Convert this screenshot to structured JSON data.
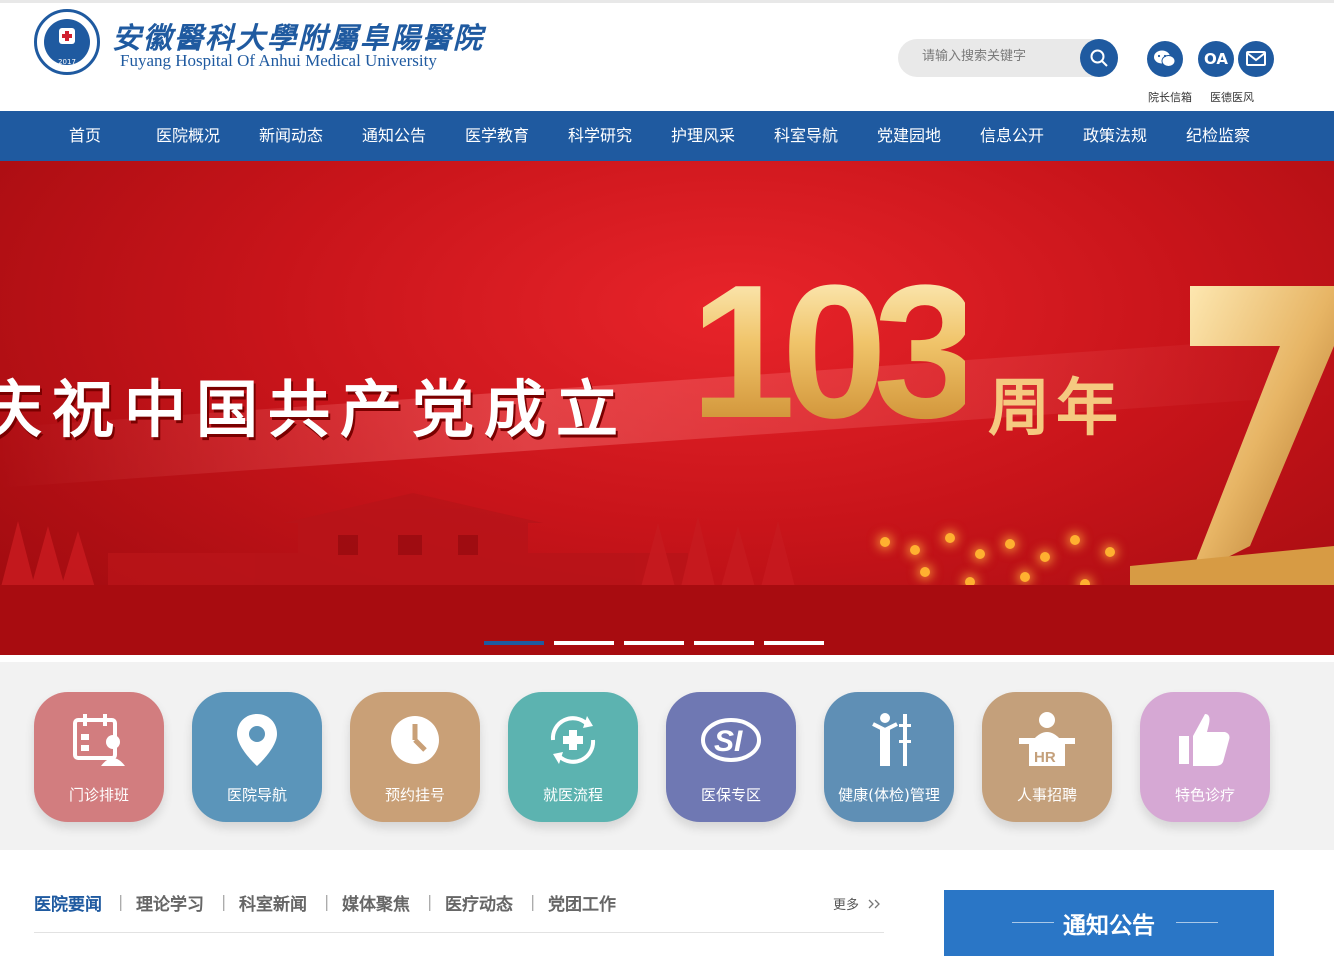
{
  "header": {
    "logo_cn": "安徽醫科大學附屬阜陽醫院",
    "logo_en": "Fuyang Hospital Of Anhui Medical University",
    "seal_year": "2017",
    "search_placeholder": "请输入搜索关键字",
    "icons": [
      {
        "name": "wechat-icon",
        "label": "院长信箱"
      },
      {
        "name": "oa-icon",
        "label": "OA",
        "caption": ""
      },
      {
        "name": "mail-icon",
        "label": "医德医风"
      }
    ],
    "oa_text": "OA"
  },
  "nav": [
    "首页",
    "医院概况",
    "新闻动态",
    "通知公告",
    "医学教育",
    "科学研究",
    "护理风采",
    "科室导航",
    "党建园地",
    "信息公开",
    "政策法规",
    "纪检监察"
  ],
  "banner": {
    "slogan": "庆祝中国共产党成立",
    "number": "103",
    "suffix": "周年",
    "slides": 5,
    "active_slide": 1
  },
  "quick_links": [
    {
      "label": "门诊排班",
      "icon": "calendar-doctor-icon",
      "color": "#d27d7f"
    },
    {
      "label": "医院导航",
      "icon": "location-pin-icon",
      "color": "#5b95ba"
    },
    {
      "label": "预约挂号",
      "icon": "clock-icon",
      "color": "#c9a077"
    },
    {
      "label": "就医流程",
      "icon": "medical-cycle-icon",
      "color": "#5cb3b0"
    },
    {
      "label": "医保专区",
      "icon": "si-logo-icon",
      "color": "#6f78b3"
    },
    {
      "label": "健康(体检)管理",
      "icon": "person-check-icon",
      "color": "#5f8fb5"
    },
    {
      "label": "人事招聘",
      "icon": "hr-desk-icon",
      "color": "#c4a07b"
    },
    {
      "label": "特色诊疗",
      "icon": "thumbs-up-icon",
      "color": "#d6a8d4"
    }
  ],
  "news_tabs": [
    "医院要闻",
    "理论学习",
    "科室新闻",
    "媒体聚焦",
    "医疗动态",
    "党团工作"
  ],
  "more_label": "更多",
  "notice_title": "通知公告",
  "colors": {
    "brand": "#1f5aa0",
    "notice": "#2a76c6"
  }
}
